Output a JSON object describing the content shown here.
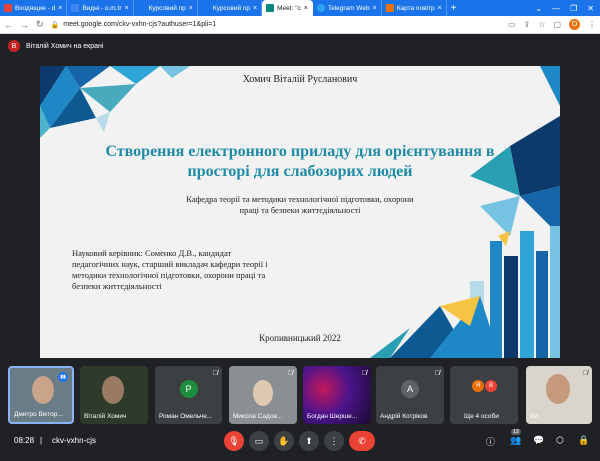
{
  "tabs": [
    {
      "label": "Входящие - d",
      "color": "#ea4335"
    },
    {
      "label": "Видні - o.m.tr",
      "color": "#4285f4"
    },
    {
      "label": "Курсовий пр",
      "color": "#1a73e8"
    },
    {
      "label": "Курсовий пр",
      "color": "#1a73e8"
    },
    {
      "label": "Meet: \"c",
      "color": "#00897b",
      "active": true
    },
    {
      "label": "Telegram Web",
      "color": "#2aa3ef"
    },
    {
      "label": "Карта повітр",
      "color": "#e8710a"
    }
  ],
  "address": {
    "url": "meet.google.com/ckv-vxhn-cjs?authuser=1&pli=1"
  },
  "profile": {
    "initial": "O"
  },
  "presenter": {
    "initial": "В",
    "text": "Віталій Хомич на екрані"
  },
  "slide": {
    "author": "Хомич Віталій Русланович",
    "title": "Створення електронного приладу для орієнтування в просторі для слабозорих людей",
    "department": "Кафедра теорії та методики технологічної підготовки, охорони праці та безпеки життєдіяльності",
    "supervisor": "Науковий керівник: Соменко Д.В., кандидат педагогічних наук, старший викладач кафедри теорії і методики технологічної підготовки, охорони праці та безпеки життєдіяльності",
    "city_year": "Кропивницький 2022"
  },
  "participants": [
    {
      "name": "Дмитро Віктор...",
      "type": "video",
      "bg": "#6a7d86"
    },
    {
      "name": "Віталій Хомич",
      "type": "video",
      "bg": "#2e3a2a"
    },
    {
      "name": "Роман Омельче...",
      "type": "avatar",
      "initial": "Р",
      "color": "#1e8e3e",
      "bg": "#3c4043"
    },
    {
      "name": "Микола Садов...",
      "type": "video",
      "bg": "#8a8f94"
    },
    {
      "name": "Богдан Шерше...",
      "type": "video",
      "bg": "#5a1a2e"
    },
    {
      "name": "Андрій Котріков",
      "type": "avatar",
      "initial": "А",
      "color": "#5f6368",
      "bg": "#3c4043"
    },
    {
      "name": "Ще 4 особи",
      "type": "more",
      "initials": [
        "Я",
        "В"
      ],
      "bg": "#3c4043"
    },
    {
      "name": "Ви",
      "type": "video",
      "bg": "#d9d4cc"
    }
  ],
  "bottom": {
    "time": "08:28",
    "separator": "|",
    "code": "ckv-vxhn-cjs",
    "people_count": "12"
  },
  "colors": {
    "accent": "#1f8ba6",
    "leave": "#ea4335"
  }
}
